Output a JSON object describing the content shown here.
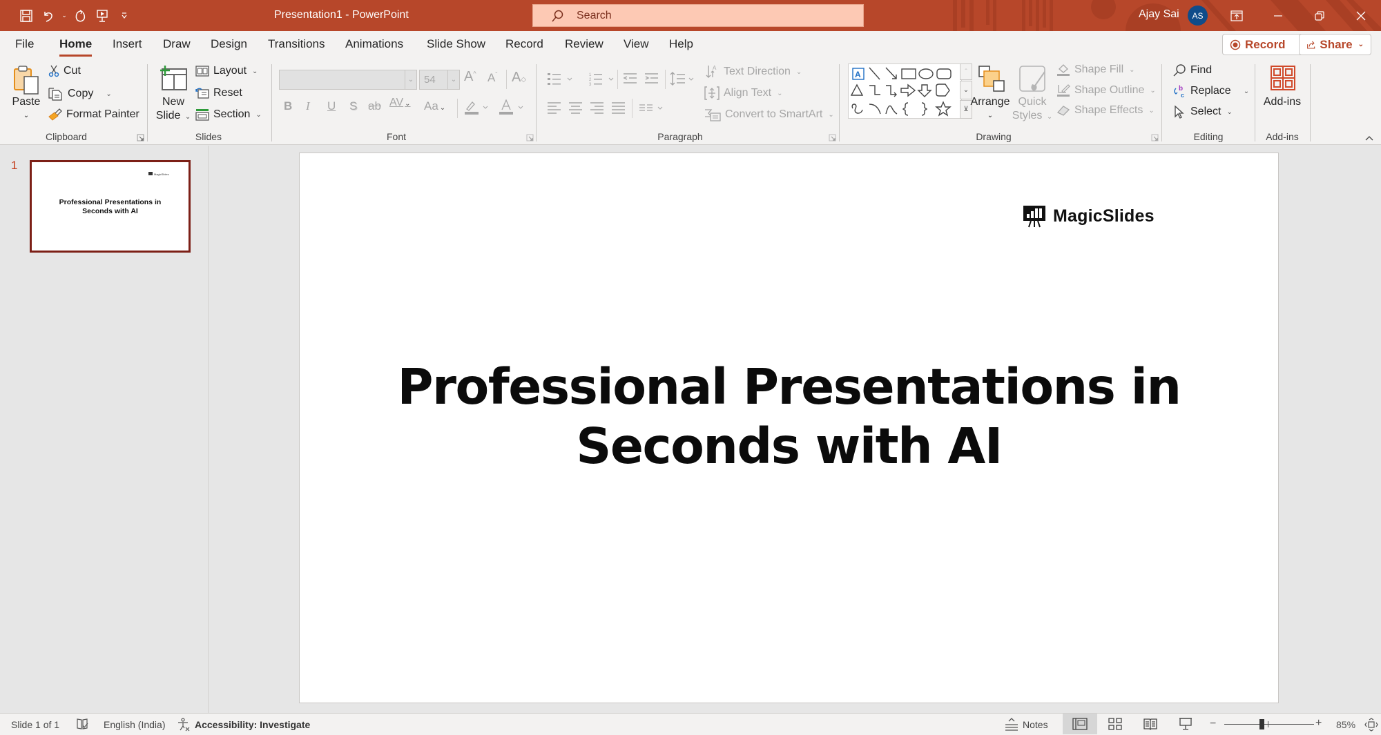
{
  "titlebar": {
    "document_title": "Presentation1  -  PowerPoint",
    "search_placeholder": "Search",
    "user_name": "Ajay Sai",
    "user_initials": "AS",
    "accent_color": "#b7472a"
  },
  "tabs": [
    {
      "label": "File"
    },
    {
      "label": "Home",
      "active": true
    },
    {
      "label": "Insert"
    },
    {
      "label": "Draw"
    },
    {
      "label": "Design"
    },
    {
      "label": "Transitions"
    },
    {
      "label": "Animations"
    },
    {
      "label": "Slide Show"
    },
    {
      "label": "Record"
    },
    {
      "label": "Review"
    },
    {
      "label": "View"
    },
    {
      "label": "Help"
    }
  ],
  "top_buttons": {
    "record": "Record",
    "share": "Share"
  },
  "ribbon": {
    "clipboard": {
      "label": "Clipboard",
      "paste": "Paste",
      "cut": "Cut",
      "copy": "Copy",
      "format_painter": "Format Painter"
    },
    "slides": {
      "label": "Slides",
      "new_slide_line1": "New",
      "new_slide_line2": "Slide",
      "layout": "Layout",
      "reset": "Reset",
      "section": "Section"
    },
    "font": {
      "label": "Font",
      "font_name": "",
      "font_size": "54",
      "bold": "B",
      "italic": "I",
      "underline": "U",
      "shadow": "S",
      "strikethrough": "ab",
      "spacing": "AV",
      "change_case": "Aa"
    },
    "paragraph": {
      "label": "Paragraph",
      "text_direction": "Text Direction",
      "align_text": "Align Text",
      "convert_smartart": "Convert to SmartArt"
    },
    "drawing": {
      "label": "Drawing",
      "arrange": "Arrange",
      "quick_styles_line1": "Quick",
      "quick_styles_line2": "Styles",
      "shape_fill": "Shape Fill",
      "shape_outline": "Shape Outline",
      "shape_effects": "Shape Effects"
    },
    "editing": {
      "label": "Editing",
      "find": "Find",
      "replace": "Replace",
      "select": "Select"
    },
    "addins": {
      "label": "Add-ins",
      "button": "Add-ins"
    }
  },
  "thumbnails": [
    {
      "number": "1",
      "title": "Professional Presentations in Seconds with AI",
      "logo": "MagicSlides"
    }
  ],
  "slide": {
    "logo_text": "MagicSlides",
    "title_line1": "Professional Presentations in",
    "title_line2": "Seconds with AI"
  },
  "statusbar": {
    "slide_counter": "Slide 1 of 1",
    "language": "English (India)",
    "accessibility": "Accessibility: Investigate",
    "notes": "Notes",
    "zoom_level": "85%",
    "zoom_percent": 85
  }
}
